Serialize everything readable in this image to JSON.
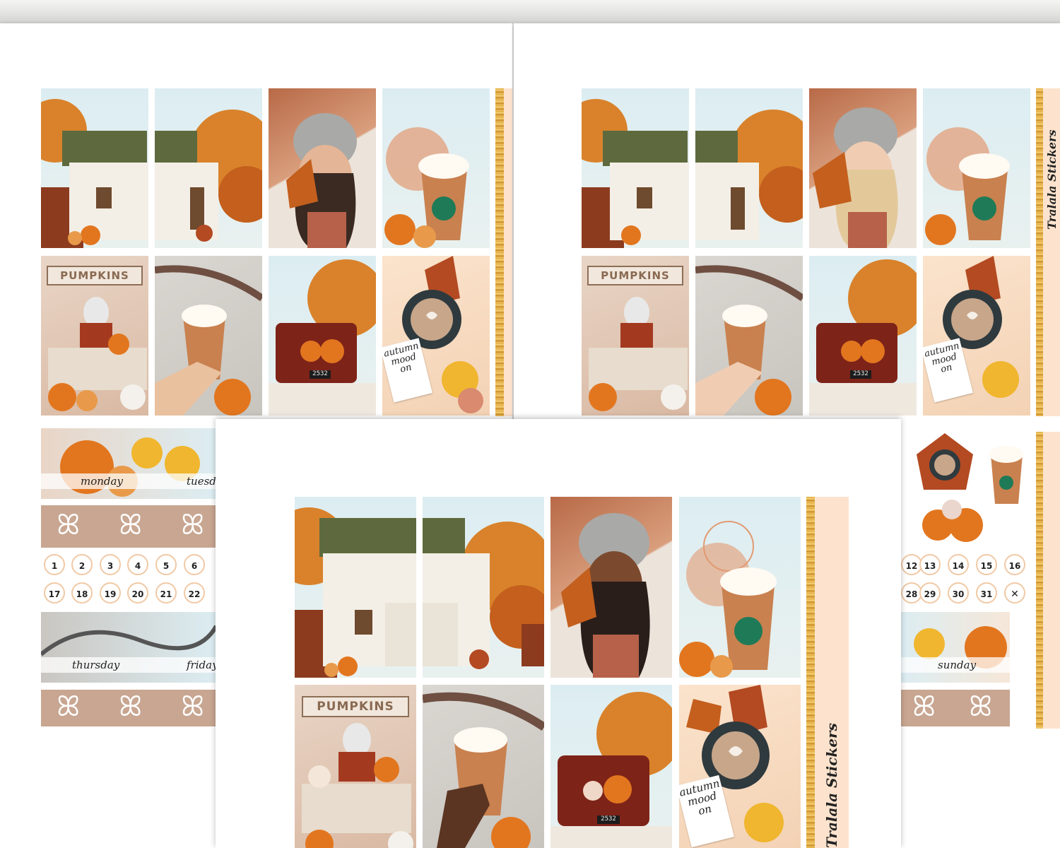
{
  "colors": {
    "sky": "#dcedf2",
    "pumpkin": "#e2761f",
    "rust": "#b86a47",
    "peach_strip": "#fde3cd",
    "bow_strip": "#c8a691",
    "glitter_gold": "#e2a93b",
    "circle_border": "#f1c9a5"
  },
  "sign": {
    "pumpkins": "PUMPKINS"
  },
  "note": {
    "line1": "autumn",
    "line2": "mood",
    "line3": "on"
  },
  "plate": {
    "number": "2532"
  },
  "icons": {
    "cup_logo": "star-icon",
    "bow": "bow-icon",
    "heart": "heart-icon",
    "leaf": "maple-leaf-icon"
  },
  "brand": {
    "name": "Tralala Stickers"
  },
  "days": {
    "mon": "monday",
    "tue": "tuesday",
    "thu": "thursday",
    "fri": "friday",
    "sun": "sunday"
  },
  "date_circles_left": {
    "row1": [
      "1",
      "2",
      "3",
      "4",
      "5",
      "6"
    ],
    "row2": [
      "17",
      "18",
      "19",
      "20",
      "21",
      "22"
    ]
  },
  "date_circles_right": {
    "row1": [
      "12",
      "13",
      "14",
      "15",
      "16"
    ],
    "row2": [
      "28",
      "29",
      "30",
      "31"
    ]
  }
}
